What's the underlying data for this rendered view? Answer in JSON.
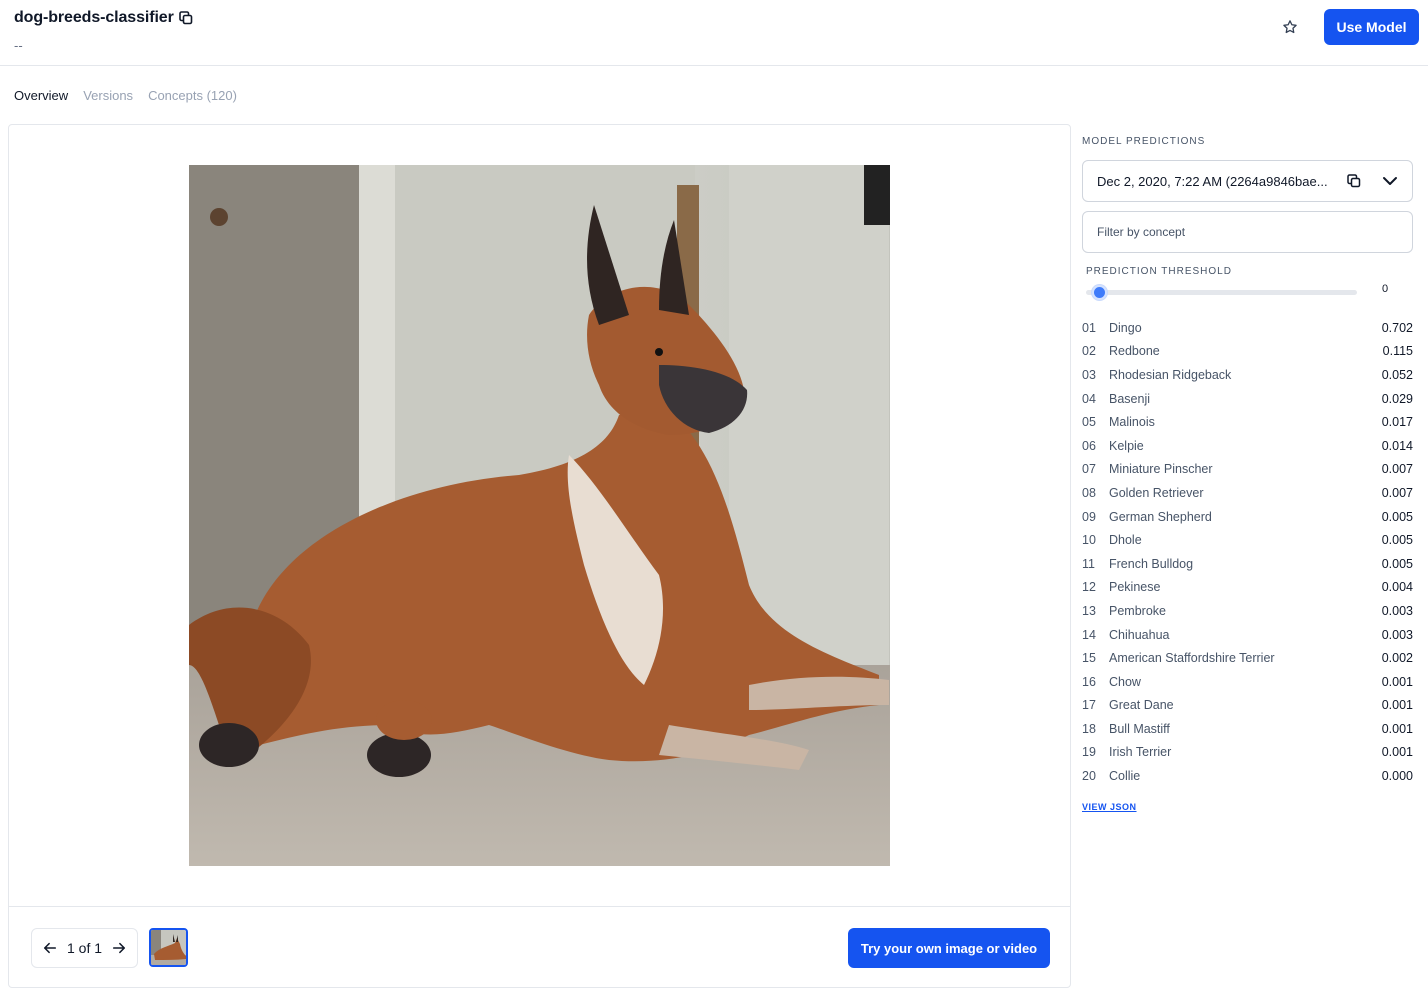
{
  "header": {
    "title": "dog-breeds-classifier",
    "subtitle": "--",
    "use_model_label": "Use Model"
  },
  "tabs": [
    {
      "label": "Overview",
      "active": true
    },
    {
      "label": "Versions",
      "active": false
    },
    {
      "label": "Concepts (120)",
      "active": false
    }
  ],
  "viewer": {
    "pager_label": "1 of 1",
    "try_button_label": "Try your own image or video"
  },
  "predictions": {
    "section_label": "MODEL PREDICTIONS",
    "version_value": "Dec 2, 2020, 7:22 AM (2264a9846bae...",
    "filter_placeholder": "Filter by concept",
    "threshold_label": "PREDICTION THRESHOLD",
    "threshold_value": "0",
    "threshold_level": 0,
    "view_json_label": "VIEW JSON",
    "items": [
      {
        "rank": "01",
        "name": "Dingo",
        "value": "0.702"
      },
      {
        "rank": "02",
        "name": "Redbone",
        "value": "0.115"
      },
      {
        "rank": "03",
        "name": "Rhodesian Ridgeback",
        "value": "0.052"
      },
      {
        "rank": "04",
        "name": "Basenji",
        "value": "0.029"
      },
      {
        "rank": "05",
        "name": "Malinois",
        "value": "0.017"
      },
      {
        "rank": "06",
        "name": "Kelpie",
        "value": "0.014"
      },
      {
        "rank": "07",
        "name": "Miniature Pinscher",
        "value": "0.007"
      },
      {
        "rank": "08",
        "name": "Golden Retriever",
        "value": "0.007"
      },
      {
        "rank": "09",
        "name": "German Shepherd",
        "value": "0.005"
      },
      {
        "rank": "10",
        "name": "Dhole",
        "value": "0.005"
      },
      {
        "rank": "11",
        "name": "French Bulldog",
        "value": "0.005"
      },
      {
        "rank": "12",
        "name": "Pekinese",
        "value": "0.004"
      },
      {
        "rank": "13",
        "name": "Pembroke",
        "value": "0.003"
      },
      {
        "rank": "14",
        "name": "Chihuahua",
        "value": "0.003"
      },
      {
        "rank": "15",
        "name": "American Staffordshire Terrier",
        "value": "0.002"
      },
      {
        "rank": "16",
        "name": "Chow",
        "value": "0.001"
      },
      {
        "rank": "17",
        "name": "Great Dane",
        "value": "0.001"
      },
      {
        "rank": "18",
        "name": "Bull Mastiff",
        "value": "0.001"
      },
      {
        "rank": "19",
        "name": "Irish Terrier",
        "value": "0.001"
      },
      {
        "rank": "20",
        "name": "Collie",
        "value": "0.000"
      }
    ]
  },
  "colors": {
    "accent": "#1554f0",
    "border": "#e4e7ec",
    "text_muted": "#98a2b3"
  },
  "icons": {
    "copy": "copy-icon",
    "star": "star-icon",
    "arrow_left": "arrow-left-icon",
    "arrow_right": "arrow-right-icon",
    "chevron_down": "chevron-down-icon"
  }
}
